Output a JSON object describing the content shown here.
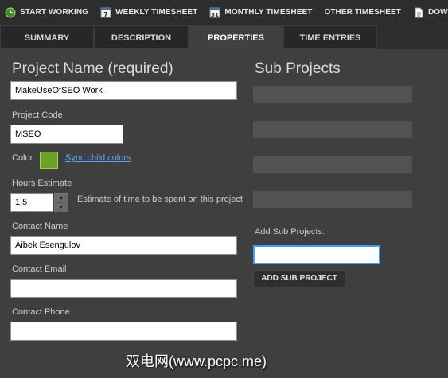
{
  "toolbar": {
    "items": [
      {
        "label": "START WORKING",
        "icon": "clock-icon"
      },
      {
        "label": "WEEKLY TIMESHEET",
        "icon": "calendar-7-icon",
        "icon_text": "7"
      },
      {
        "label": "MONTHLY TIMESHEET",
        "icon": "calendar-31-icon",
        "icon_text": "31"
      },
      {
        "label": "OTHER TIMESHEET",
        "icon": ""
      },
      {
        "label": "DOWNLOAD",
        "icon": "document-icon"
      }
    ]
  },
  "tabs": [
    {
      "label": "SUMMARY",
      "active": false
    },
    {
      "label": "DESCRIPTION",
      "active": false
    },
    {
      "label": "PROPERTIES",
      "active": true
    },
    {
      "label": "TIME ENTRIES",
      "active": false
    }
  ],
  "form": {
    "project_name": {
      "heading": "Project Name (required)",
      "value": "MakeUseOfSEO Work"
    },
    "project_code": {
      "label": "Project Code",
      "value": "MSEO"
    },
    "color": {
      "label": "Color",
      "value": "#6aa321",
      "sync_link": "Sync child colors"
    },
    "hours_estimate": {
      "label": "Hours Estimate",
      "value": "1.5",
      "hint": "Estimate of time to be spent on this project"
    },
    "contact_name": {
      "label": "Contact Name",
      "value": "Aibek Esengulov"
    },
    "contact_email": {
      "label": "Contact Email",
      "value": ""
    },
    "contact_phone": {
      "label": "Contact Phone",
      "value": ""
    }
  },
  "sub_projects": {
    "heading": "Sub Projects",
    "add_label": "Add Sub Projects:",
    "input_value": "",
    "button_label": "ADD SUB PROJECT"
  },
  "watermark": "双电网(www.pcpc.me)",
  "colors": {
    "accent_focus": "#3fa0ff",
    "link": "#5aa7ff",
    "swatch": "#6aa321"
  }
}
